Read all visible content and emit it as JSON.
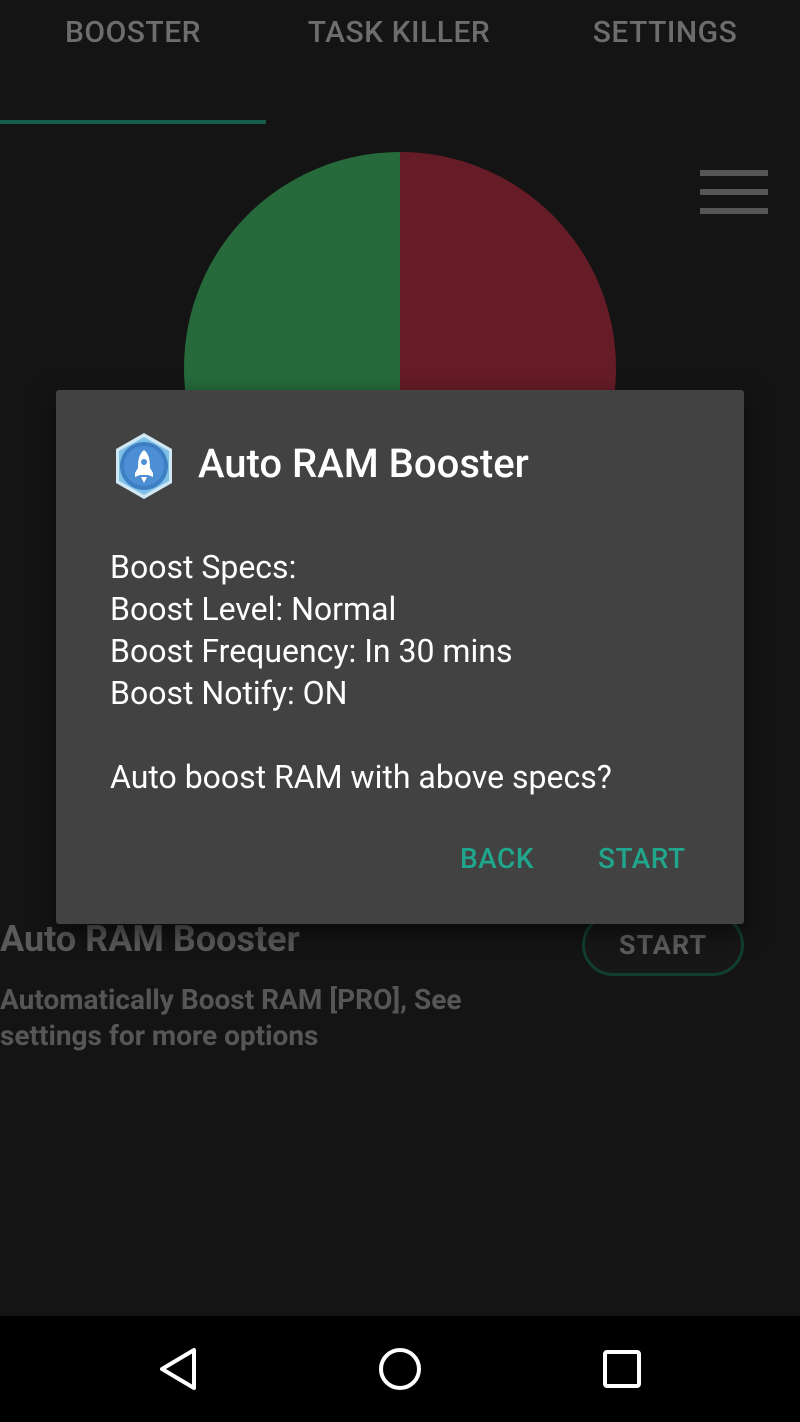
{
  "tabs": [
    {
      "label": "BOOSTER",
      "selected": true
    },
    {
      "label": "TASK KILLER",
      "selected": false
    },
    {
      "label": "SETTINGS",
      "selected": false
    }
  ],
  "colors": {
    "accent": "#1fa68c",
    "tab_indicator": "#155c4f",
    "pie_free": "#266a3b",
    "pie_used": "#661c27",
    "dialog_bg": "#424242"
  },
  "ram_pie": {
    "free_fraction": 0.5,
    "used_fraction": 0.5
  },
  "menu": {
    "icon": "hamburger-menu-icon"
  },
  "booster_card": {
    "title": "Auto RAM Booster",
    "description": "Automatically Boost RAM [PRO], See settings for more options",
    "start_label": "START"
  },
  "dialog": {
    "icon": "rocket-icon",
    "title": "Auto RAM Booster",
    "lines": [
      "Boost Specs:",
      "Boost Level: Normal",
      "Boost Frequency: In 30 mins",
      "Boost Notify: ON"
    ],
    "question": "Auto boost RAM with above specs?",
    "back_label": "BACK",
    "start_label": "START"
  },
  "navbar": {
    "back_icon": "back-triangle-icon",
    "home_icon": "home-circle-icon",
    "recents_icon": "recents-square-icon"
  }
}
